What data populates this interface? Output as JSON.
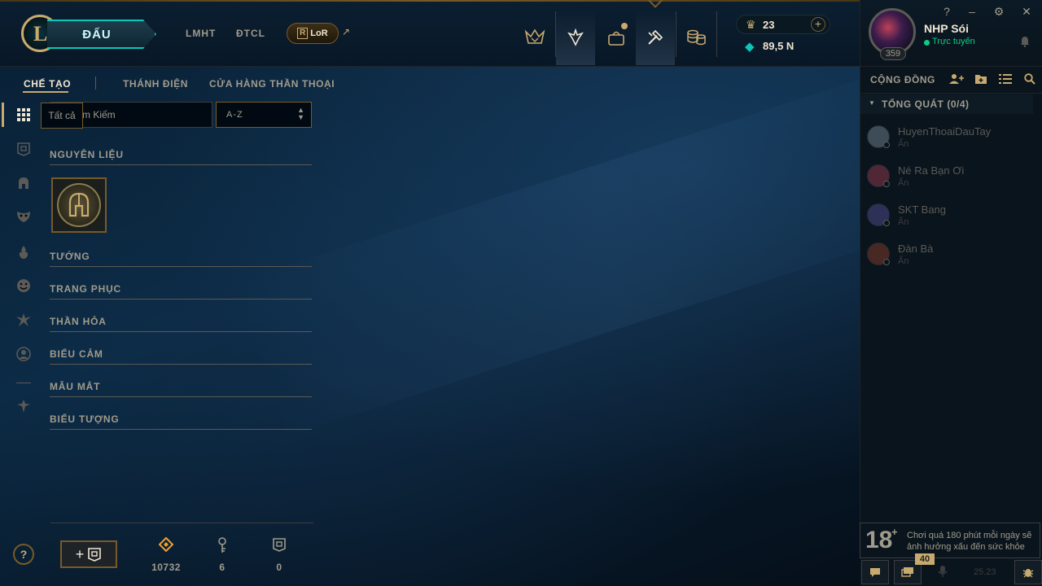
{
  "topnav": {
    "logo_letter": "L",
    "play_label": "ĐẤU",
    "links": [
      "LMHT",
      "ĐTCL"
    ],
    "lor_letter": "R",
    "lor_label": "LoR",
    "ext_arrow": "↗"
  },
  "currency": {
    "rp": "23",
    "be": "89,5 N",
    "plus": "+"
  },
  "window": {
    "help": "?",
    "minimize": "–",
    "settings": "⚙",
    "close": "✕"
  },
  "profile": {
    "name": "NHP Sói",
    "status": "Trực tuyến",
    "level": "359"
  },
  "subtabs": [
    "CHẾ TẠO",
    "THÁNH ĐIỆN",
    "CỬA HÀNG THẦN THOẠI"
  ],
  "filter": {
    "tooltip": "Tất cả",
    "search_value": "m Kiếm",
    "sort_value": "A-Z"
  },
  "sections": [
    "NGUYÊN LIỆU",
    "TƯỚNG",
    "TRANG PHỤC",
    "THẦN HỎA",
    "BIỂU CẢM",
    "MẪU MẮT",
    "BIỂU TƯỢNG"
  ],
  "resources": {
    "essence": "10732",
    "keys": "6",
    "chests": "0"
  },
  "social": {
    "title": "CỘNG ĐỒNG",
    "group": "TỔNG QUÁT (0/4)",
    "friends": [
      {
        "name": "HuyenThoaiDauTay",
        "status": "Ẩn",
        "color": "#6a7a8a"
      },
      {
        "name": "Né Ra Bạn Ơi",
        "status": "Ẩn",
        "color": "#8a3a4a"
      },
      {
        "name": "SKT Bang",
        "status": "Ẩn",
        "color": "#4a4a8a"
      },
      {
        "name": "Đàn Bà",
        "status": "Ẩn",
        "color": "#7a3a2a"
      }
    ]
  },
  "age_notice": {
    "age": "18",
    "plus": "+",
    "text": "Chơi quá 180 phút mỗi ngày sẽ ảnh hưởng xấu đến sức khỏe"
  },
  "bottom": {
    "badge": "40",
    "version": "25.23"
  },
  "colors": {
    "gold": "#c8aa6e",
    "teal": "#0ac8b9",
    "online": "#0acf83"
  }
}
